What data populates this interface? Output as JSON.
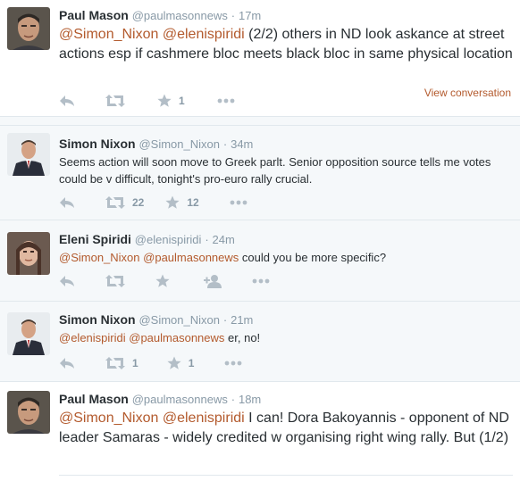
{
  "tweets": [
    {
      "fullname": "Paul Mason",
      "username": "@paulmasonnews",
      "sep": "·",
      "time": "17m",
      "mentions": [
        "@Simon_Nixon",
        "@elenispiridi"
      ],
      "text": " (2/2) others in ND look askance at street actions esp if cashmere bloc meets black bloc in same physical location",
      "favorites": "1",
      "view_conversation": "View conversation"
    },
    {
      "fullname": "Simon Nixon",
      "username": "@Simon_Nixon",
      "sep": "·",
      "time": "34m",
      "text": "Seems action will soon move to Greek parlt. Senior opposition source tells me votes could be v difficult, tonight's pro-euro rally crucial.",
      "retweets": "22",
      "favorites": "12"
    },
    {
      "fullname": "Eleni Spiridi",
      "username": "@elenispiridi",
      "sep": "·",
      "time": "24m",
      "mentions": [
        "@Simon_Nixon",
        "@paulmasonnews"
      ],
      "text": " could you be more specific?"
    },
    {
      "fullname": "Simon Nixon",
      "username": "@Simon_Nixon",
      "sep": "·",
      "time": "21m",
      "mentions": [
        "@elenispiridi",
        "@paulmasonnews"
      ],
      "text": " er, no!",
      "retweets": "1",
      "favorites": "1"
    },
    {
      "fullname": "Paul Mason",
      "username": "@paulmasonnews",
      "sep": "·",
      "time": "18m",
      "mentions": [
        "@Simon_Nixon",
        "@elenispiridi"
      ],
      "text": " I can! Dora Bakoyannis - opponent of ND leader Samaras - widely credited w organising right wing rally. But (1/2)"
    }
  ],
  "icons": {
    "reply": "reply-icon",
    "retweet": "retweet-icon",
    "favorite": "star-icon",
    "follow": "follow-icon",
    "more": "more-icon"
  },
  "colors": {
    "link": "#b35a2d",
    "meta": "#8899a6",
    "icon": "#b3bec7",
    "reply_bg": "#f5f8fa",
    "focused_bg": "#ffffff"
  }
}
